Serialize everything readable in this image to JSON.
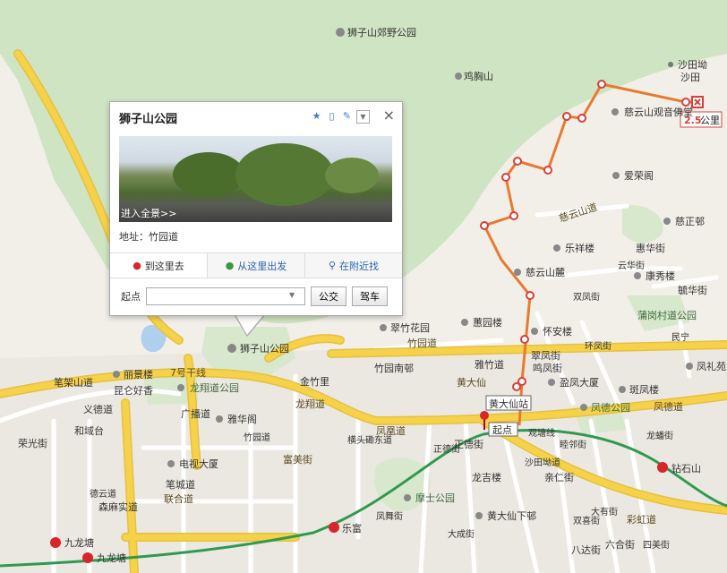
{
  "popup": {
    "title": "狮子山公园",
    "close_label": "×",
    "pano_label": "进入全景>>",
    "address_label": "地址：",
    "address_value": "竹园道",
    "tabs": [
      {
        "label": "到这里去",
        "icon": "red-pin-icon"
      },
      {
        "label": "从这里出发",
        "icon": "green-pin-icon"
      },
      {
        "label": "在附近找",
        "icon": "search-icon"
      }
    ],
    "start_label": "起点",
    "start_value": "",
    "bus_button": "公交",
    "car_button": "驾车"
  },
  "route": {
    "distance_value": "2.5",
    "distance_unit": "公里",
    "color": "#e87a2e",
    "start_tag": "起点",
    "station_tag": "黄大仙站"
  },
  "places": {
    "p1": "狮子山郊野公园",
    "p2": "鸡胸山",
    "p3": "沙田坳",
    "p4": "慈云山观音佛堂",
    "p5": "慈云山道",
    "p6": "爱荣阁",
    "p7": "慈正邨",
    "p8": "乐祥楼",
    "p9": "惠华街",
    "p10": "慈云山麓",
    "p11": "康秀楼",
    "p12": "毓华街",
    "p13": "云华街",
    "p14": "双凤街",
    "p15": "蒲岗村道公园",
    "p16": "翠竹花园",
    "p17": "蕙园楼",
    "p18": "怀安楼",
    "p19": "竹园道",
    "p20": "雅竹道",
    "p21": "翠凤街",
    "p22": "鸣凤街",
    "p23": "环凤街",
    "p24": "竹园南邨",
    "p25": "黄大仙",
    "p26": "盈凤大厦",
    "p27": "斑凤楼",
    "p28": "凤德公园",
    "p29": "凤德道",
    "p30": "笔架山道",
    "p31": "丽景楼",
    "p32": "昆仑好香",
    "p33": "龙翔道公园",
    "p34": "义德道",
    "p35": "和域台",
    "p36": "广播道",
    "p37": "雅华阁",
    "p38": "竹园道",
    "p39": "龙翔道",
    "p40": "金竹里",
    "p41": "富美街",
    "p42": "横头磡东道",
    "p43": "电视大厦",
    "p44": "笔城道",
    "p45": "联合道",
    "p46": "德云道",
    "p47": "森麻实道",
    "p48": "乐富",
    "p49": "凤舞街",
    "p50": "正德街",
    "p51": "龙吉楼",
    "p52": "正德街",
    "p53": "摩士公园",
    "p54": "沙田坳道",
    "p55": "亲仁街",
    "p56": "睦邻街",
    "p57": "黄大仙下邨",
    "p58": "大成街",
    "p59": "双喜街",
    "p60": "大有街",
    "p61": "八达街",
    "p62": "六合街",
    "p63": "四美街",
    "p64": "彩虹道",
    "p65": "钻石山",
    "p66": "九龙塘",
    "p67": "荣光街",
    "p68": "沙田",
    "p69": "观塘线",
    "p70": "7号干线",
    "p71": "狮子山公园",
    "p72": "民宁",
    "p73": "凤礼苑",
    "p74": "凤凰道",
    "p75": "龙蟠街",
    "p76": "沙田坳"
  },
  "colors": {
    "water": "#aed0ee",
    "green": "#cfe4c2",
    "major_road": "#f6d24a",
    "minor_road": "#ffffff",
    "route": "#e87a2e",
    "metro": "#2f9a4f"
  }
}
